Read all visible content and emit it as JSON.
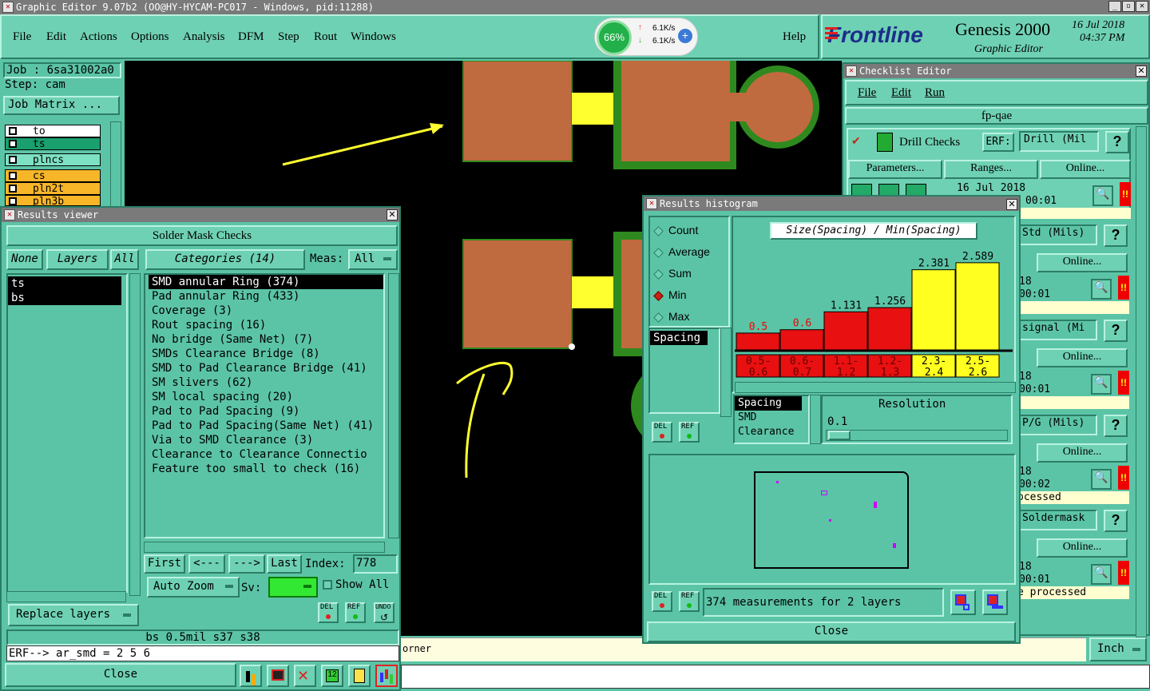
{
  "app": {
    "window_title": "Graphic Editor 9.07b2 (OO@HY-HYCAM-PC017 - Windows, pid:11288)",
    "menu": [
      "File",
      "Edit",
      "Actions",
      "Options",
      "Analysis",
      "DFM",
      "Step",
      "Rout",
      "Windows"
    ],
    "help": "Help",
    "brand": "Frontline",
    "product": "Genesis 2000",
    "subtitle": "Graphic Editor",
    "date": "16 Jul 2018",
    "time": "04:37 PM"
  },
  "netmeter": {
    "percent": "66%",
    "up": "6.1K/s",
    "down": "6.1K/s"
  },
  "left": {
    "job": "Job : 6sa31002a0",
    "step": "Step: cam",
    "job_matrix": "Job Matrix ...",
    "layers": [
      "to",
      "ts",
      "plncs",
      "cs",
      "pln2t",
      "pln3b"
    ]
  },
  "results_viewer": {
    "title": "Results viewer",
    "header": "Solder Mask Checks",
    "none_btn": "None",
    "layers_btn": "Layers",
    "all_btn": "All",
    "layer_list": [
      "ts",
      "bs"
    ],
    "categories_btn": "Categories (14)",
    "meas_label": "Meas:",
    "meas_value": "All",
    "categories": [
      "SMD annular Ring (374)",
      "Pad annular Ring (433)",
      "Coverage (3)",
      "Rout spacing (16)",
      "No bridge (Same Net) (7)",
      "SMDs Clearance Bridge (8)",
      "SMD to Pad Clearance Bridge (41)",
      "SM slivers (62)",
      "SM local spacing (20)",
      "Pad to Pad Spacing (9)",
      "Pad to Pad Spacing(Same Net) (41)",
      "Via to SMD Clearance (3)",
      "Clearance to Clearance Connectio",
      "Feature too small to check (16)"
    ],
    "first": "First",
    "prev": "<---",
    "next": "--->",
    "last": "Last",
    "index_label": "Index:",
    "index_value": "778",
    "auto_zoom": "Auto Zoom",
    "sv_label": "Sv:",
    "show_all": "Show All",
    "replace_layers": "Replace layers",
    "del": "DEL",
    "ref": "REF",
    "undo": "UNDO",
    "status1": "bs 0.5mil   s37   s38",
    "status2": "ERF--> ar_smd = 2 5 6",
    "close": "Close"
  },
  "canvas": {
    "note": "orner"
  },
  "histogram": {
    "title": "Results histogram",
    "modes": [
      "Count",
      "Average",
      "Sum",
      "Min",
      "Max"
    ],
    "selected_mode": "Min",
    "chart_title": "Size(Spacing) / Min(Spacing)",
    "list": [
      "Spacing"
    ],
    "list2": [
      "Spacing",
      "SMD",
      "Clearance"
    ],
    "resolution_label": "Resolution",
    "resolution_value": "0.1",
    "footer": "374 measurements for 2 layers",
    "close": "Close",
    "del": "DEL",
    "ref": "REF"
  },
  "chart_data": {
    "type": "bar",
    "title": "Size(Spacing) / Min(Spacing)",
    "categories": [
      "0.5-0.6",
      "0.6-0.7",
      "1.1-1.2",
      "1.2-1.3",
      "2.3-2.4",
      "2.5-2.6"
    ],
    "values": [
      0.5,
      0.6,
      1.131,
      1.256,
      2.381,
      2.589
    ],
    "value_labels": [
      "0.5",
      "0.6",
      "1.131",
      "1.256",
      "2.381",
      "2.589"
    ],
    "range_top": [
      "0.5-",
      "0.6-",
      "1.1-",
      "1.2-",
      "2.3-",
      "2.5-"
    ],
    "range_bottom": [
      "0.6",
      "0.7",
      "1.2",
      "1.3",
      "2.4",
      "2.6"
    ],
    "colors": [
      "#e81010",
      "#e81010",
      "#e81010",
      "#e81010",
      "#ffff20",
      "#ffff20"
    ],
    "ylim": [
      0,
      2.8
    ]
  },
  "checklist": {
    "title": "Checklist Editor",
    "menu": [
      "File",
      "Edit",
      "Run"
    ],
    "name": "fp-qae",
    "drill_checks": "Drill Checks",
    "erf_label": "ERF:",
    "erf_values": [
      "Drill (Mil",
      "Std (Mils)",
      "signal (Mi",
      "P/G (Mils)",
      "Soldermask"
    ],
    "parameters": "Parameters...",
    "ranges": "Ranges...",
    "online": "Online...",
    "row_date": "16 Jul 2018",
    "row_time": "00:01",
    "row_times": [
      "00:01",
      "00:01",
      "00:01",
      "00:02",
      "00:01"
    ],
    "row_day": "18",
    "processed": "ocessed",
    "processed2": "e processed",
    "help": "?"
  },
  "units": "Inch"
}
